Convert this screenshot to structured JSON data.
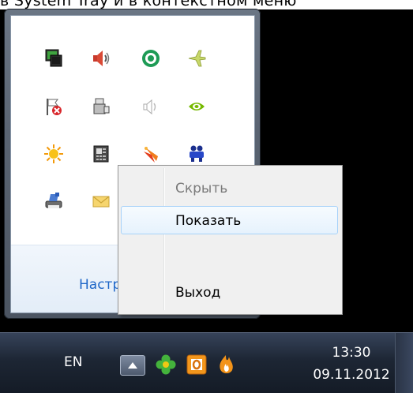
{
  "top_caption": "в System Tray и в контекстном меню",
  "flyout": {
    "customize_link": "Настроить..."
  },
  "tray_icons": [
    {
      "name": "network-icon"
    },
    {
      "name": "speaker-red-icon"
    },
    {
      "name": "green-ring-icon"
    },
    {
      "name": "airplane-icon"
    },
    {
      "name": "action-center-error-icon"
    },
    {
      "name": "usb-device-icon"
    },
    {
      "name": "volume-muted-icon"
    },
    {
      "name": "nvidia-icon"
    },
    {
      "name": "sun-icon"
    },
    {
      "name": "phone-device-icon"
    },
    {
      "name": "flame-icon"
    },
    {
      "name": "people-icon"
    },
    {
      "name": "printer-icon"
    },
    {
      "name": "envelope-icon"
    }
  ],
  "context_menu": {
    "items": [
      {
        "label": "Скрыть",
        "state": "disabled"
      },
      {
        "label": "Показать",
        "state": "hover"
      },
      {
        "label": "",
        "state": "empty"
      },
      {
        "label": "Выход",
        "state": "normal"
      }
    ]
  },
  "taskbar": {
    "language": "EN",
    "time": "13:30",
    "date": "09.11.2012"
  },
  "colors": {
    "link": "#1e66c8",
    "menu_hover_border": "#a8d2f9",
    "taskbar": "#1d2634"
  }
}
